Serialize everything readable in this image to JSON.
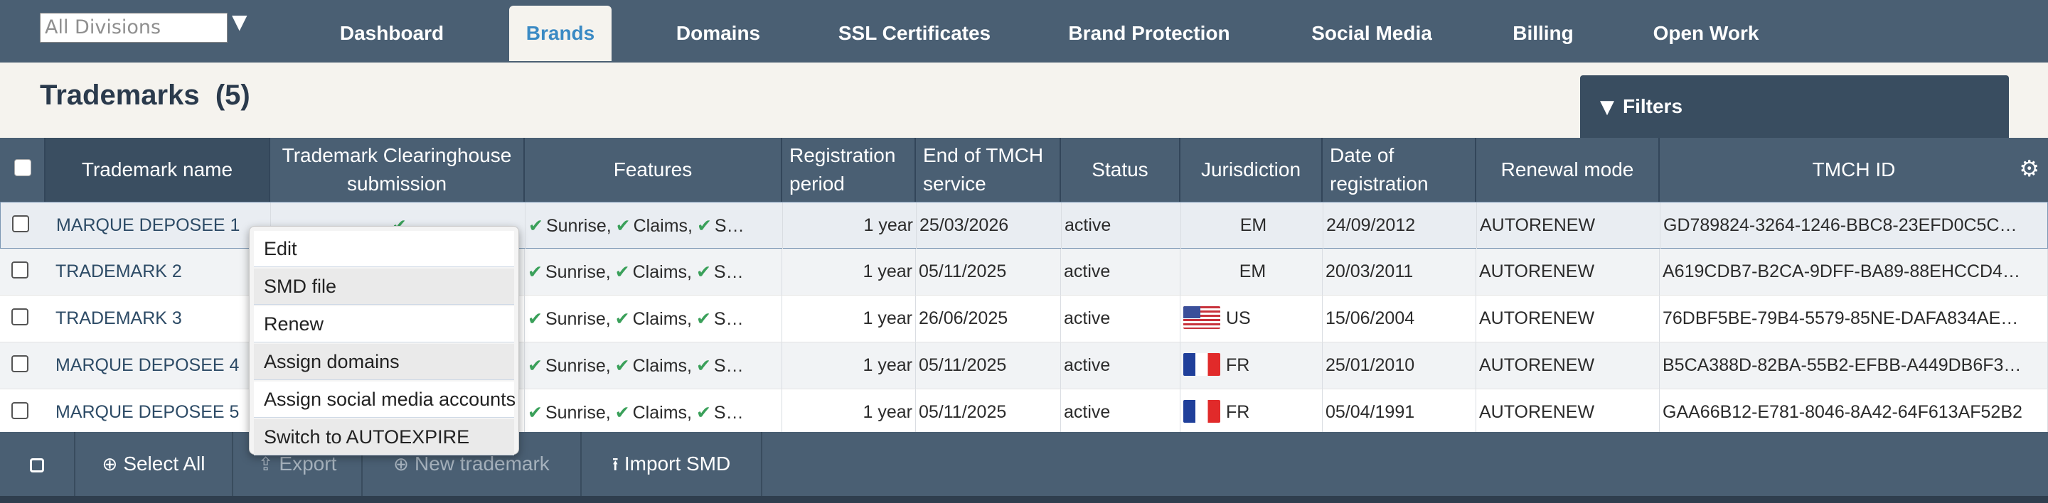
{
  "topnav": {
    "division_value": "All Divisions",
    "division_caret_icon": "caret-down",
    "tabs": [
      {
        "label": "Dashboard"
      },
      {
        "label": "Brands",
        "active": true
      },
      {
        "label": "Domains"
      },
      {
        "label": "SSL Certificates"
      },
      {
        "label": "Brand Protection"
      },
      {
        "label": "Social Media"
      },
      {
        "label": "Billing"
      },
      {
        "label": "Open Work"
      }
    ]
  },
  "page": {
    "title": "Trademarks",
    "count": "(5)"
  },
  "filters": {
    "label": "Filters",
    "icon": "filter-triangle"
  },
  "table": {
    "columns": [
      "Trademark name",
      "Trademark Clearinghouse submission",
      "Features",
      "Registration period",
      "End of TMCH service",
      "Status",
      "Jurisdiction",
      "Date of registration",
      "Renewal mode",
      "TMCH ID"
    ],
    "settings_icon": "gear-icon",
    "rows": [
      {
        "name": "MARQUE DEPOSEE 1",
        "submission": "✔",
        "features": [
          "Sunrise,",
          "Claims,",
          "S…"
        ],
        "period": "1 year",
        "end": "25/03/2026",
        "status": "active",
        "flag": "",
        "jurisdiction": "EM",
        "date": "24/09/2012",
        "renewal": "AUTORENEW",
        "tmch_id": "GD789824-3264-1246-BBC8-23EFD0C5C…"
      },
      {
        "name": "TRADEMARK 2",
        "submission": "",
        "features": [
          "Sunrise,",
          "Claims,",
          "S…"
        ],
        "period": "1 year",
        "end": "05/11/2025",
        "status": "active",
        "flag": "",
        "jurisdiction": "EM",
        "date": "20/03/2011",
        "renewal": "AUTORENEW",
        "tmch_id": "A619CDB7-B2CA-9DFF-BA89-88EHCCD4…"
      },
      {
        "name": "TRADEMARK 3",
        "submission": "",
        "features": [
          "Sunrise,",
          "Claims,",
          "S…"
        ],
        "period": "1 year",
        "end": "26/06/2025",
        "status": "active",
        "flag": "us",
        "jurisdiction": "US",
        "date": "15/06/2004",
        "renewal": "AUTORENEW",
        "tmch_id": "76DBF5BE-79B4-5579-85NE-DAFA834AE…"
      },
      {
        "name": "MARQUE DEPOSEE 4",
        "submission": "",
        "features": [
          "Sunrise,",
          "Claims,",
          "S…"
        ],
        "period": "1 year",
        "end": "05/11/2025",
        "status": "active",
        "flag": "fr",
        "jurisdiction": "FR",
        "date": "25/01/2010",
        "renewal": "AUTORENEW",
        "tmch_id": "B5CA388D-82BA-55B2-EFBB-A449DB6F3…"
      },
      {
        "name": "MARQUE DEPOSEE 5",
        "submission": "",
        "features": [
          "Sunrise,",
          "Claims,",
          "S…"
        ],
        "period": "1 year",
        "end": "05/11/2025",
        "status": "active",
        "flag": "fr",
        "jurisdiction": "FR",
        "date": "05/04/1991",
        "renewal": "AUTORENEW",
        "tmch_id": "GAA66B12-E781-8046-8A42-64F613AF52B2"
      }
    ]
  },
  "context_menu": {
    "items": [
      "Edit",
      "SMD file",
      "Renew",
      "Assign domains",
      "Assign social media accounts",
      "Switch to AUTOEXPIRE"
    ]
  },
  "bottombar": {
    "select_all": "Select All",
    "export": "Export",
    "new_trademark": "New trademark",
    "import_smd": "Import SMD"
  },
  "colors": {
    "nav_bg": "#4a5f73",
    "accent": "#3a8ac4",
    "check_green": "#3aa05a"
  }
}
